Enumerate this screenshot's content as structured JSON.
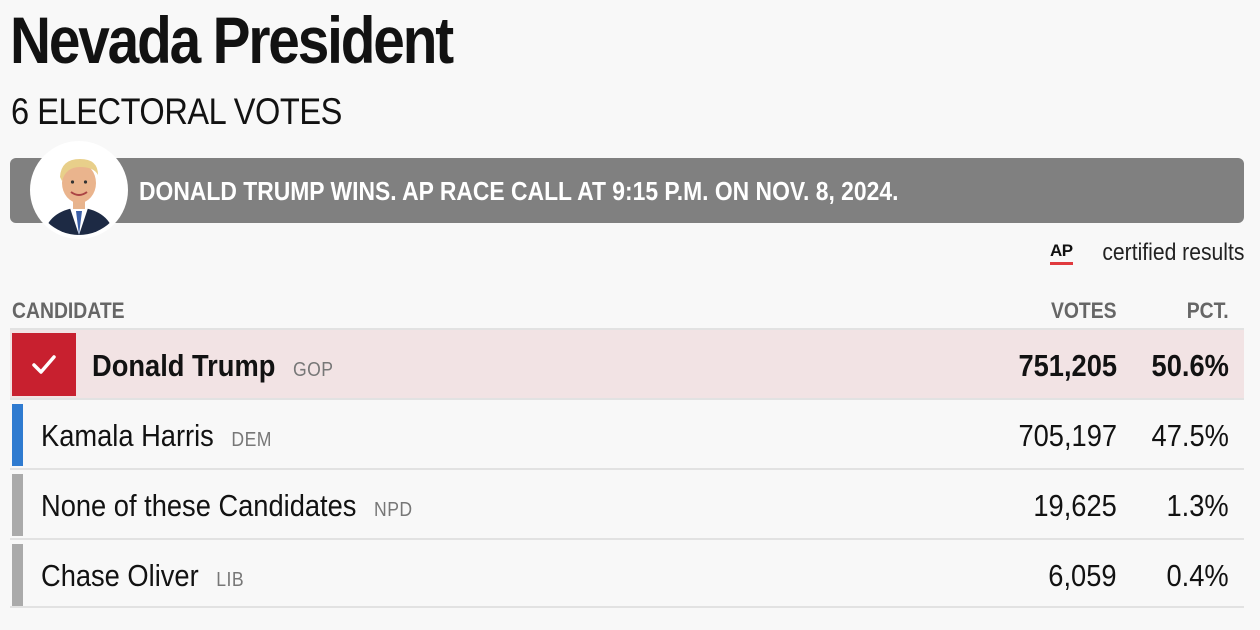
{
  "header": {
    "title": "Nevada President",
    "subtitle": "6 ELECTORAL VOTES"
  },
  "banner": {
    "text": "DONALD TRUMP WINS. AP RACE CALL AT 9:15 P.M. ON NOV. 8, 2024.",
    "avatar_icon": "candidate-portrait"
  },
  "source": {
    "logo": "AP",
    "text": "certified results"
  },
  "table": {
    "columns": {
      "candidate": "CANDIDATE",
      "votes": "VOTES",
      "pct": "PCT."
    },
    "rows": [
      {
        "name": "Donald Trump",
        "party": "GOP",
        "votes": "751,205",
        "pct": "50.6%",
        "color": "#c8202f",
        "winner": true
      },
      {
        "name": "Kamala Harris",
        "party": "DEM",
        "votes": "705,197",
        "pct": "47.5%",
        "color": "#2f7bd0",
        "winner": false
      },
      {
        "name": "None of these Candidates",
        "party": "NPD",
        "votes": "19,625",
        "pct": "1.3%",
        "color": "#aaaaaa",
        "winner": false
      },
      {
        "name": "Chase Oliver",
        "party": "LIB",
        "votes": "6,059",
        "pct": "0.4%",
        "color": "#aaaaaa",
        "winner": false
      }
    ]
  },
  "colors": {
    "winner_red": "#c8202f",
    "winner_row_bg": "#f2e3e4",
    "dem_blue": "#2f7bd0",
    "other_gray": "#aaaaaa",
    "banner_gray": "#808080"
  }
}
